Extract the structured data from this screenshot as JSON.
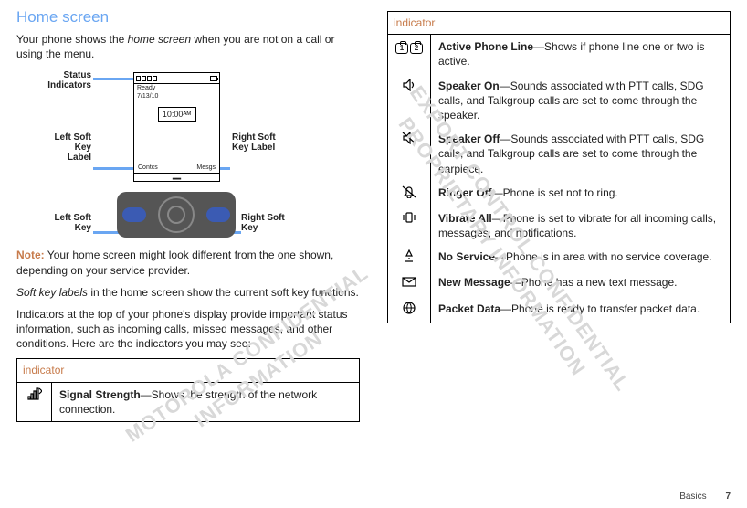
{
  "left": {
    "heading": "Home screen",
    "intro_a": "Your phone shows the ",
    "intro_em": "home screen",
    "intro_b": " when you are not on a call or using the menu.",
    "note_label": "Note:",
    "note_text": " Your home screen might look different from the one shown, depending on your service provider.",
    "p2_a": "Soft key labels",
    "p2_b": " in the home screen show the current soft key functions.",
    "p3": "Indicators at the top of your phone's display provide important status information, such as incoming calls, missed messages, and other conditions. Here are the indicators you may see:",
    "table_header": "indicator",
    "row1_name": "Signal Strength",
    "row1_desc": "—Shows the strength of the network connection."
  },
  "diagram": {
    "status": "Status\nIndicators",
    "lsk_label": "Left\nSoft Key\nLabel",
    "rsk_label": "Right\nSoft Key\nLabel",
    "lsk": "Left\nSoft Key",
    "rsk": "Right\nSoft Key",
    "screen_ready": "Ready",
    "screen_date": "7/13/10",
    "screen_time": "10:00ᴬᴹ",
    "sk_left": "Contcs",
    "sk_right": "Mesgs"
  },
  "right": {
    "table_header": "indicator",
    "rows": [
      {
        "name": "Active Phone Line",
        "desc": "—Shows if phone line one or two is active."
      },
      {
        "name": "Speaker On",
        "desc": "—Sounds associated with PTT calls, SDG calls, and Talkgroup calls are set to come through the speaker."
      },
      {
        "name": "Speaker Off",
        "desc": "—Sounds associated with PTT calls, SDG calls, and Talkgroup calls are set to come through the earpiece."
      },
      {
        "name": "Ringer Off",
        "desc": "—Phone is set not to ring."
      },
      {
        "name": "Vibrate All",
        "desc": "—Phone is set to vibrate for all incoming calls, messages, and notifications."
      },
      {
        "name": "No Service",
        "desc": "—Phone is in area with no service coverage."
      },
      {
        "name": "New Message",
        "desc": "—Phone has a new text message."
      },
      {
        "name": "Packet Data",
        "desc": "—Phone is ready to transfer packet data."
      }
    ]
  },
  "footer": {
    "section": "Basics",
    "page": "7"
  },
  "wm1": "MOTOROLA CONFIDENTIAL\n          INFORMATION",
  "wm2": "EXPORT CONTROL CONFIDENTIAL\n   PROPRIETARY INFORMATION"
}
